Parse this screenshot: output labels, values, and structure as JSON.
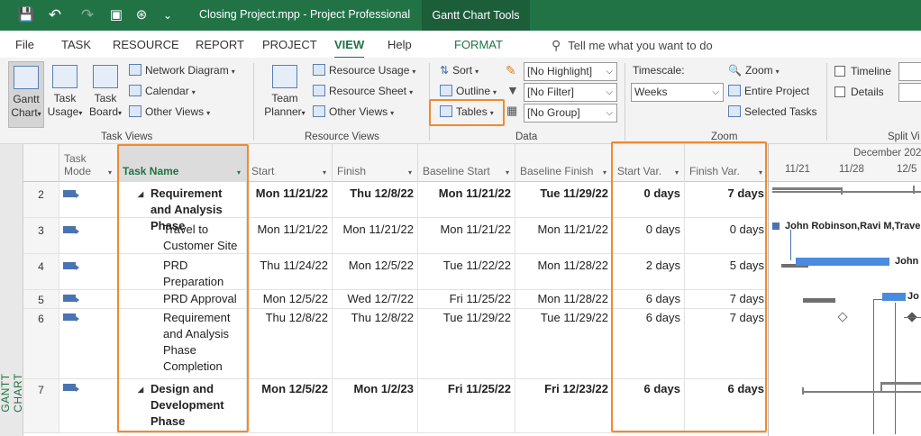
{
  "titlebar": {
    "doc_title": "Closing Project.mpp  -  Project Professional",
    "tools_tab": "Gantt Chart Tools",
    "save_glyph": "💾",
    "undo_glyph": "↶",
    "redo_glyph": "↷",
    "customize_glyph": "⌄"
  },
  "menu": {
    "tabs": [
      "File",
      "TASK",
      "RESOURCE",
      "REPORT",
      "PROJECT",
      "VIEW",
      "Help",
      "FORMAT"
    ],
    "active": "VIEW",
    "tellme": "Tell me what you want to do"
  },
  "ribbon": {
    "task_views": {
      "gantt_chart": "Gantt\nChart",
      "task_usage": "Task\nUsage",
      "task_board": "Task\nBoard",
      "network_diagram": "Network Diagram",
      "calendar": "Calendar",
      "other_views": "Other Views",
      "label": "Task Views"
    },
    "resource_views": {
      "team_planner": "Team\nPlanner",
      "resource_usage": "Resource Usage",
      "resource_sheet": "Resource Sheet",
      "other_views": "Other Views",
      "label": "Resource Views"
    },
    "data": {
      "sort": "Sort",
      "outline": "Outline",
      "tables": "Tables",
      "highlight": "[No Highlight]",
      "filter": "[No Filter]",
      "group": "[No Group]",
      "label": "Data"
    },
    "zoom": {
      "timescale_label": "Timescale:",
      "timescale_value": "Weeks",
      "zoom": "Zoom",
      "entire_project": "Entire Project",
      "selected_tasks": "Selected Tasks",
      "label": "Zoom"
    },
    "split_view": {
      "timeline": "Timeline",
      "details": "Details",
      "label": "Split Vi"
    }
  },
  "side_label": "GANTT CHART",
  "table": {
    "headers": {
      "task_mode": "Task\nMode",
      "task_name": "Task Name",
      "start": "Start",
      "finish": "Finish",
      "baseline_start": "Baseline Start",
      "baseline_finish": "Baseline Finish",
      "start_var": "Start Var.",
      "finish_var": "Finish Var."
    },
    "rows": [
      {
        "id": "2",
        "name": "Requirement and Analysis Phase",
        "start": "Mon 11/21/22",
        "finish": "Thu 12/8/22",
        "baseline_start": "Mon 11/21/22",
        "baseline_finish": "Tue 11/29/22",
        "start_var": "0 days",
        "finish_var": "7 days",
        "summary": true
      },
      {
        "id": "3",
        "name": "Travel to Customer Site",
        "start": "Mon 11/21/22",
        "finish": "Mon 11/21/22",
        "baseline_start": "Mon 11/21/22",
        "baseline_finish": "Mon 11/21/22",
        "start_var": "0 days",
        "finish_var": "0 days",
        "summary": false
      },
      {
        "id": "4",
        "name": "PRD Preparation",
        "start": "Thu 11/24/22",
        "finish": "Mon 12/5/22",
        "baseline_start": "Tue 11/22/22",
        "baseline_finish": "Mon 11/28/22",
        "start_var": "2 days",
        "finish_var": "5 days",
        "summary": false
      },
      {
        "id": "5",
        "name": "PRD Approval",
        "start": "Mon 12/5/22",
        "finish": "Wed 12/7/22",
        "baseline_start": "Fri 11/25/22",
        "baseline_finish": "Mon 11/28/22",
        "start_var": "6 days",
        "finish_var": "7 days",
        "summary": false
      },
      {
        "id": "6",
        "name": "Requirement and Analysis Phase Completion",
        "start": "Thu 12/8/22",
        "finish": "Thu 12/8/22",
        "baseline_start": "Tue 11/29/22",
        "baseline_finish": "Tue 11/29/22",
        "start_var": "6 days",
        "finish_var": "7 days",
        "summary": false
      },
      {
        "id": "7",
        "name": "Design and Development Phase",
        "start": "Mon 12/5/22",
        "finish": "Mon 1/2/23",
        "baseline_start": "Fri 11/25/22",
        "baseline_finish": "Fri 12/23/22",
        "start_var": "6 days",
        "finish_var": "6 days",
        "summary": true
      }
    ]
  },
  "timeline": {
    "month": "December 202",
    "weeks": [
      "11/21",
      "11/28",
      "12/5"
    ],
    "labels": {
      "row3": "John Robinson,Ravi M,Travel",
      "row4": "John",
      "row5": "Jo"
    }
  },
  "colors": {
    "brand_green": "#217346",
    "highlight_orange": "#f08a2e",
    "task_bar_blue": "#4a8be0",
    "baseline_gray": "#7f7f7f"
  }
}
